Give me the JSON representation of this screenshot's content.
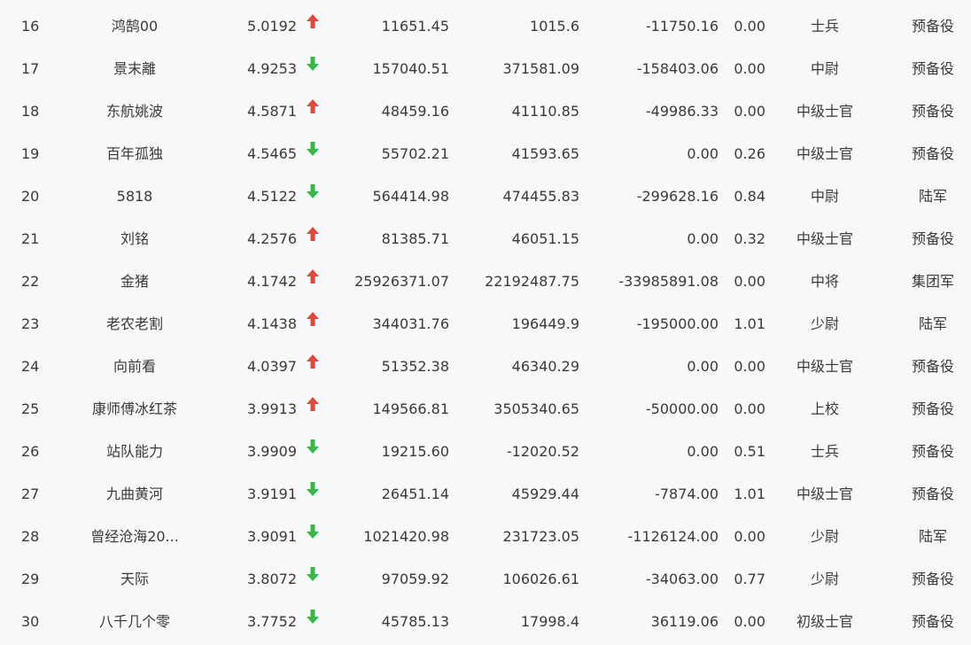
{
  "colors": {
    "up": "#e8453c",
    "down": "#39b54a"
  },
  "rows": [
    {
      "rank": "16",
      "name": "鸿鹄00",
      "score": "5.0192",
      "trend": "up",
      "v1": "11651.45",
      "v2": "1015.6",
      "v3": "-11750.16",
      "v4": "0.00",
      "title": "士兵",
      "type": "预备役"
    },
    {
      "rank": "17",
      "name": "景末離",
      "score": "4.9253",
      "trend": "down",
      "v1": "157040.51",
      "v2": "371581.09",
      "v3": "-158403.06",
      "v4": "0.00",
      "title": "中尉",
      "type": "预备役"
    },
    {
      "rank": "18",
      "name": "东航姚波",
      "score": "4.5871",
      "trend": "up",
      "v1": "48459.16",
      "v2": "41110.85",
      "v3": "-49986.33",
      "v4": "0.00",
      "title": "中级士官",
      "type": "预备役"
    },
    {
      "rank": "19",
      "name": "百年孤独",
      "score": "4.5465",
      "trend": "down",
      "v1": "55702.21",
      "v2": "41593.65",
      "v3": "0.00",
      "v4": "0.26",
      "title": "中级士官",
      "type": "预备役"
    },
    {
      "rank": "20",
      "name": "5818",
      "score": "4.5122",
      "trend": "down",
      "v1": "564414.98",
      "v2": "474455.83",
      "v3": "-299628.16",
      "v4": "0.84",
      "title": "中尉",
      "type": "陆军"
    },
    {
      "rank": "21",
      "name": "刘铭",
      "score": "4.2576",
      "trend": "up",
      "v1": "81385.71",
      "v2": "46051.15",
      "v3": "0.00",
      "v4": "0.32",
      "title": "中级士官",
      "type": "预备役"
    },
    {
      "rank": "22",
      "name": "金猪",
      "score": "4.1742",
      "trend": "up",
      "v1": "25926371.07",
      "v2": "22192487.75",
      "v3": "-33985891.08",
      "v4": "0.00",
      "title": "中将",
      "type": "集团军"
    },
    {
      "rank": "23",
      "name": "老农老割",
      "score": "4.1438",
      "trend": "up",
      "v1": "344031.76",
      "v2": "196449.9",
      "v3": "-195000.00",
      "v4": "1.01",
      "title": "少尉",
      "type": "陆军"
    },
    {
      "rank": "24",
      "name": "向前看",
      "score": "4.0397",
      "trend": "up",
      "v1": "51352.38",
      "v2": "46340.29",
      "v3": "0.00",
      "v4": "0.00",
      "title": "中级士官",
      "type": "预备役"
    },
    {
      "rank": "25",
      "name": "康师傅冰红茶",
      "score": "3.9913",
      "trend": "up",
      "v1": "149566.81",
      "v2": "3505340.65",
      "v3": "-50000.00",
      "v4": "0.00",
      "title": "上校",
      "type": "预备役"
    },
    {
      "rank": "26",
      "name": "站队能力",
      "score": "3.9909",
      "trend": "down",
      "v1": "19215.60",
      "v2": "-12020.52",
      "v3": "0.00",
      "v4": "0.51",
      "title": "士兵",
      "type": "预备役"
    },
    {
      "rank": "27",
      "name": "九曲黄河",
      "score": "3.9191",
      "trend": "down",
      "v1": "26451.14",
      "v2": "45929.44",
      "v3": "-7874.00",
      "v4": "1.01",
      "title": "中级士官",
      "type": "预备役"
    },
    {
      "rank": "28",
      "name": "曾经沧海20...",
      "score": "3.9091",
      "trend": "down",
      "v1": "1021420.98",
      "v2": "231723.05",
      "v3": "-1126124.00",
      "v4": "0.00",
      "title": "少尉",
      "type": "陆军"
    },
    {
      "rank": "29",
      "name": "天际",
      "score": "3.8072",
      "trend": "down",
      "v1": "97059.92",
      "v2": "106026.61",
      "v3": "-34063.00",
      "v4": "0.77",
      "title": "少尉",
      "type": "预备役"
    },
    {
      "rank": "30",
      "name": "八千几个零",
      "score": "3.7752",
      "trend": "down",
      "v1": "45785.13",
      "v2": "17998.4",
      "v3": "36119.06",
      "v4": "0.00",
      "title": "初级士官",
      "type": "预备役"
    }
  ]
}
